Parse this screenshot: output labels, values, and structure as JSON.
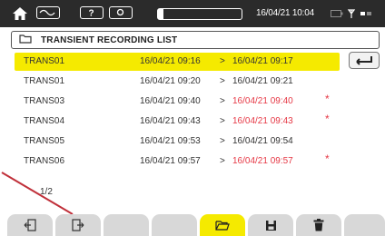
{
  "status_bar": {
    "datetime": "16/04/21 10:04",
    "icons": [
      "home-icon",
      "waveform-icon",
      "help-icon",
      "camera-icon",
      "memory-progress",
      "battery-icon",
      "antenna-icon",
      "network-icon"
    ],
    "memory_fill_percent": 6
  },
  "title_bar": {
    "icon": "folder-icon",
    "title": "TRANSIENT RECORDING LIST"
  },
  "recordings": [
    {
      "name": "TRANS01",
      "start": "16/04/21 09:16",
      "arrow": ">",
      "end": "16/04/21 09:17",
      "end_color": "black",
      "mark": "",
      "selected": true
    },
    {
      "name": "TRANS01",
      "start": "16/04/21 09:20",
      "arrow": ">",
      "end": "16/04/21 09:21",
      "end_color": "black",
      "mark": "",
      "selected": false
    },
    {
      "name": "TRANS03",
      "start": "16/04/21 09:40",
      "arrow": ">",
      "end": "16/04/21 09:40",
      "end_color": "red",
      "mark": "*",
      "selected": false
    },
    {
      "name": "TRANS04",
      "start": "16/04/21 09:43",
      "arrow": ">",
      "end": "16/04/21 09:43",
      "end_color": "red",
      "mark": "*",
      "selected": false
    },
    {
      "name": "TRANS05",
      "start": "16/04/21 09:53",
      "arrow": ">",
      "end": "16/04/21 09:54",
      "end_color": "black",
      "mark": "",
      "selected": false
    },
    {
      "name": "TRANS06",
      "start": "16/04/21 09:57",
      "arrow": ">",
      "end": "16/04/21 09:57",
      "end_color": "red",
      "mark": "*",
      "selected": false
    }
  ],
  "enter_button": {
    "icon": "enter-return-icon"
  },
  "pagination": "1/2",
  "function_keys": [
    {
      "icon": "back-page-icon",
      "active": false
    },
    {
      "icon": "next-page-icon",
      "active": false
    },
    {
      "icon": "",
      "active": false
    },
    {
      "icon": "",
      "active": false
    },
    {
      "icon": "open-folder-icon",
      "active": true
    },
    {
      "icon": "save-icon",
      "active": false
    },
    {
      "icon": "trash-icon",
      "active": false
    },
    {
      "icon": "",
      "active": false
    }
  ],
  "colors": {
    "status_bar_bg": "#2b2b2b",
    "selection": "#f5ea00",
    "alert_red": "#e63946",
    "key_bg": "#d8d8d8",
    "pointer_line": "#c0303a"
  }
}
